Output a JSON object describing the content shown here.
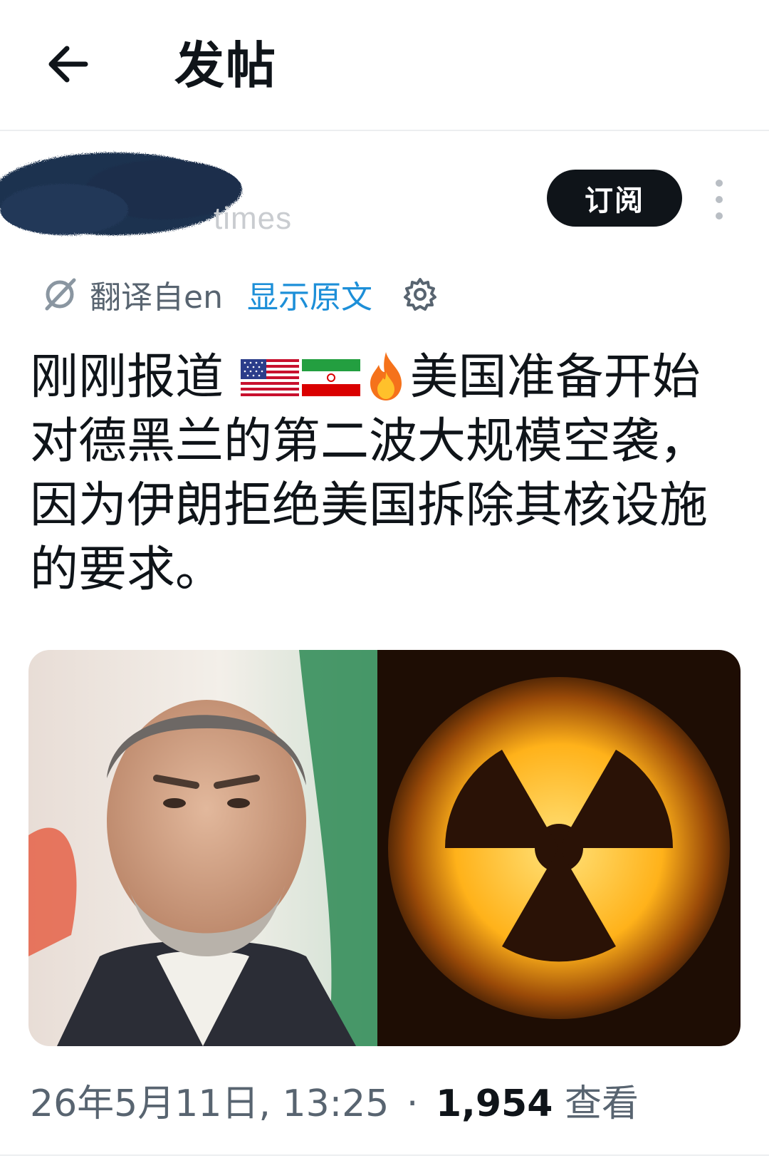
{
  "header": {
    "title": "发帖"
  },
  "author": {
    "handle_fragment": "times",
    "subscribe_label": "订阅"
  },
  "translation": {
    "translated_from": "翻译自en",
    "show_original": "显示原文"
  },
  "post": {
    "text_part1": "刚刚报道",
    "text_part2": "美国准备开始对德黑兰的第二波大规模空袭，因为伊朗拒绝美国拆除其核设施的要求。",
    "emojis": [
      "us-flag-icon",
      "iran-flag-icon",
      "fire-icon"
    ]
  },
  "media": {
    "images": [
      "portrait-photo",
      "radiation-symbol-image"
    ]
  },
  "meta": {
    "timestamp": "26年5月11日, 13:25",
    "separator": "·",
    "views_count": "1,954",
    "views_label": "查看"
  },
  "colors": {
    "accent": "#1d8fd8",
    "text": "#0f1419",
    "muted": "#586470",
    "button": "#0f1419"
  }
}
